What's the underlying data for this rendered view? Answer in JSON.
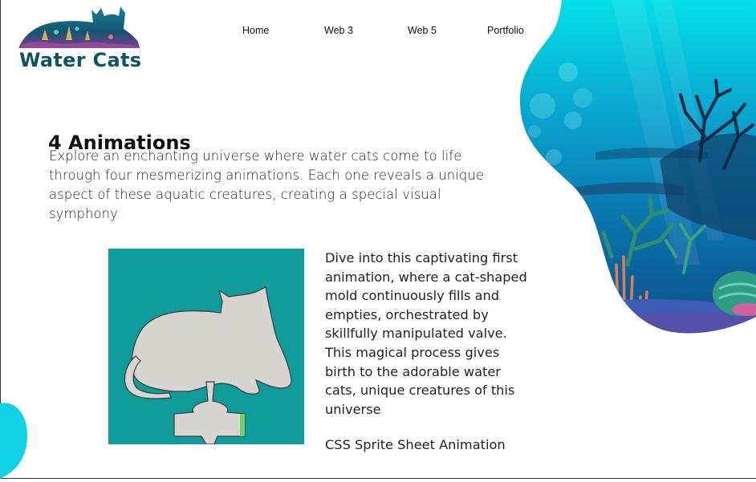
{
  "brand": {
    "name": "Water Cats"
  },
  "nav": {
    "items": [
      "Home",
      "Web 3",
      "Web 5",
      "Portfolio"
    ]
  },
  "main": {
    "title": "4 Animations",
    "intro": "Explore an enchanting universe where water cats come to life through four mesmerizing animations. Each one reveals a unique aspect of these aquatic creatures, creating a special visual symphony"
  },
  "animation": {
    "description": "Dive into this captivating first animation, where a cat-shaped mold continuously fills and empties, orchestrated by skillfully manipulated valve. This magical process gives birth to the adorable water cats, unique creatures of this universe",
    "caption": "CSS Sprite Sheet Animation",
    "fill_level": 0.05
  },
  "colors": {
    "brand_text": "#0d5467",
    "animation_bg": "#109c9a",
    "cat_mold": "#d6d5cf",
    "water_fill": "#6fd36a",
    "ocean_top": "#05dfe6",
    "ocean_deep": "#0b5f96"
  }
}
